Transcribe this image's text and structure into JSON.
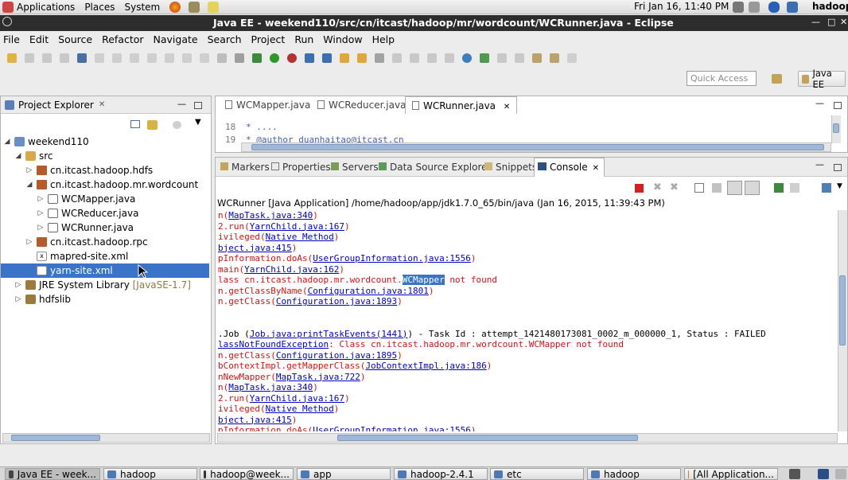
{
  "panel": {
    "applications": "Applications",
    "places": "Places",
    "system": "System",
    "clock": "Fri Jan 16, 11:40 PM",
    "user": "hadoop"
  },
  "window": {
    "title": "Java EE - weekend110/src/cn/itcast/hadoop/mr/wordcount/WCRunner.java - Eclipse"
  },
  "menu": [
    "File",
    "Edit",
    "Source",
    "Refactor",
    "Navigate",
    "Search",
    "Project",
    "Run",
    "Window",
    "Help"
  ],
  "toolbar": {
    "quick_access_placeholder": "Quick Access",
    "perspective": "Java EE"
  },
  "project_explorer": {
    "title": "Project Explorer",
    "items": [
      {
        "label": "weekend110"
      },
      {
        "label": "src"
      },
      {
        "label": "cn.itcast.hadoop.hdfs"
      },
      {
        "label": "cn.itcast.hadoop.mr.wordcount"
      },
      {
        "label": "WCMapper.java"
      },
      {
        "label": "WCReducer.java"
      },
      {
        "label": "WCRunner.java"
      },
      {
        "label": "cn.itcast.hadoop.rpc"
      },
      {
        "label": "mapred-site.xml"
      },
      {
        "label": "yarn-site.xml"
      },
      {
        "label": "JRE System Library",
        "suffix": "[JavaSE-1.7]"
      },
      {
        "label": "hdfslib"
      }
    ]
  },
  "editor": {
    "tabs": [
      "WCMapper.java",
      "WCReducer.java",
      "WCRunner.java"
    ],
    "lines": [
      {
        "num": "18",
        "text": " * ...."
      },
      {
        "num": "19",
        "text": " * @author duanhaitao@itcast.cn"
      }
    ]
  },
  "views": {
    "tabs": [
      "Markers",
      "Properties",
      "Servers",
      "Data Source Explorer",
      "Snippets",
      "Console"
    ]
  },
  "console": {
    "header": "WCRunner [Java Application] /home/hadoop/app/jdk1.7.0_65/bin/java (Jan 16, 2015, 11:39:43 PM)",
    "lines": [
      {
        "pre": "n(",
        "link": "MapTask.java:340",
        "post": ")"
      },
      {
        "pre": "2.run(",
        "link": "YarnChild.java:167",
        "post": ")"
      },
      {
        "pre": "ivileged(",
        "link": "Native Method",
        "post": ")"
      },
      {
        "pre": "",
        "link": "bject.java:415",
        "post": ")"
      },
      {
        "pre": "pInformation.doAs(",
        "link": "UserGroupInformation.java:1556",
        "post": ")"
      },
      {
        "pre": "main(",
        "link": "YarnChild.java:162",
        "post": ")"
      },
      {
        "pre": "lass cn.itcast.hadoop.mr.wordcount.",
        "hl": "WCMapper",
        "post": " not found"
      },
      {
        "pre": "n.getClassByName(",
        "link": "Configuration.java:1801",
        "post": ")"
      },
      {
        "pre": "n.getClass(",
        "link": "Configuration.java:1893",
        "post": ")"
      },
      {
        "pre": "",
        "post": ""
      },
      {
        "pre": "",
        "post": ""
      },
      {
        "blkpre": ".Job (",
        "link": "Job.java:printTaskEvents(1441)",
        "blkpost": ") - Task Id : attempt_1421480173081_0002_m_000000_1, Status : FAILED"
      },
      {
        "lpre": "lassNotFoundException",
        "post": ": Class cn.itcast.hadoop.mr.wordcount.WCMapper not found"
      },
      {
        "pre": "n.getClass(",
        "link": "Configuration.java:1895",
        "post": ")"
      },
      {
        "pre": "bContextImpl.getMapperClass(",
        "link": "JobContextImpl.java:186",
        "post": ")"
      },
      {
        "pre": "nNewMapper(",
        "link": "MapTask.java:722",
        "post": ")"
      },
      {
        "pre": "n(",
        "link": "MapTask.java:340",
        "post": ")"
      },
      {
        "pre": "2.run(",
        "link": "YarnChild.java:167",
        "post": ")"
      },
      {
        "pre": "ivileged(",
        "link": "Native Method",
        "post": ")"
      },
      {
        "pre": "",
        "link": "bject.java:415",
        "post": ")"
      },
      {
        "pre": "pInformation.doAs(",
        "link": "UserGroupInformation.java:1556",
        "post": ")"
      }
    ]
  },
  "taskbar": [
    {
      "label": "Java EE - week..."
    },
    {
      "label": "hadoop"
    },
    {
      "label": "hadoop@week..."
    },
    {
      "label": "app"
    },
    {
      "label": "hadoop-2.4.1"
    },
    {
      "label": "etc"
    },
    {
      "label": "hadoop"
    },
    {
      "label": "[All Application..."
    }
  ]
}
